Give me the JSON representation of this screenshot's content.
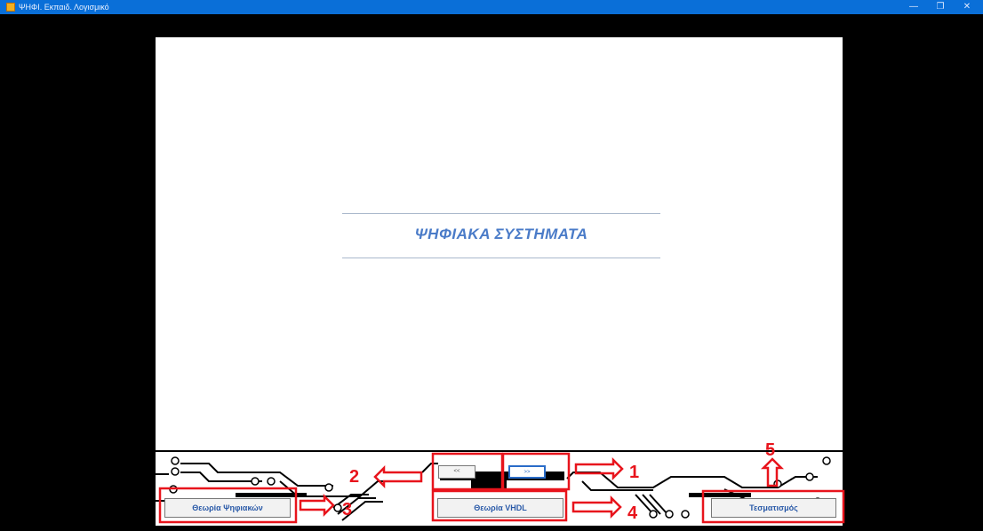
{
  "window": {
    "title": "ΨΗΦΙ. Εκπαιδ. Λογισμικό",
    "minimize": "—",
    "maximize": "❐",
    "close": "✕"
  },
  "app_title": "ΨΗΦΙΑΚΑ ΣΥΣΤΗΜΑΤΑ",
  "nav": {
    "prev_label": "<<",
    "next_label": ">>"
  },
  "buttons": {
    "theory_digital": "Θεωρία Ψηφιακών",
    "theory_vhdl": "Θεωρία VHDL",
    "testing": "Τεσματισμός"
  },
  "annotations": [
    "1",
    "2",
    "3",
    "4",
    "5"
  ],
  "colors": {
    "titlebar": "#0a6fd8",
    "accent": "#4a7bc8",
    "annotation": "#e8141c"
  }
}
